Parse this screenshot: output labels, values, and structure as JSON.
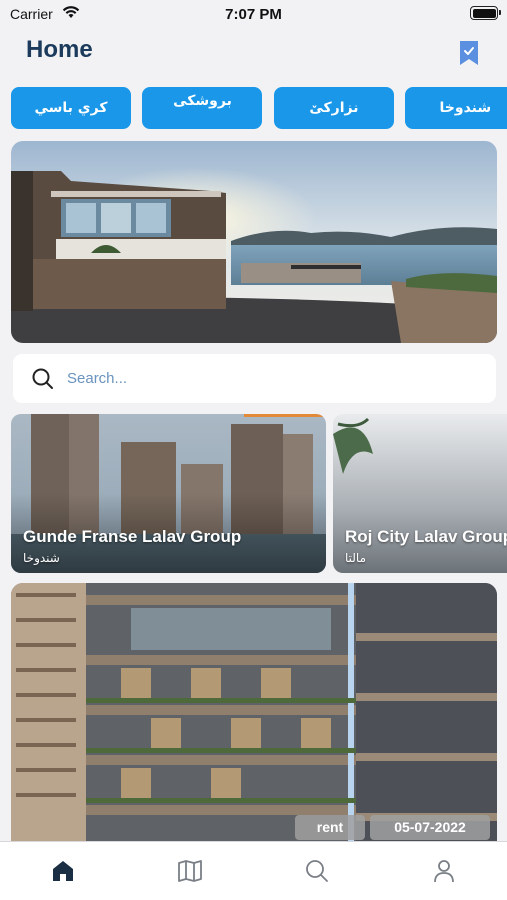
{
  "status_bar": {
    "carrier": "Carrier",
    "time": "7:07 PM"
  },
  "header": {
    "title": "Home",
    "bookmark_icon": "bookmark-check-icon"
  },
  "categories": [
    {
      "label": "كري باسي"
    },
    {
      "label": "بروشكى"
    },
    {
      "label": "نزاركێ"
    },
    {
      "label": "شندوخا"
    }
  ],
  "search": {
    "placeholder": "Search..."
  },
  "featured_cards": [
    {
      "title": "Gunde Franse Lalav Group",
      "subtitle": "شندوخا"
    },
    {
      "title": "Roj City Lalav Group",
      "subtitle": "مالتا"
    }
  ],
  "listing": {
    "type_tag": "rent",
    "date_tag": "05-07-2022"
  },
  "tabbar": {
    "tabs": [
      {
        "icon": "home-icon",
        "active": true
      },
      {
        "icon": "map-icon",
        "active": false
      },
      {
        "icon": "search-icon",
        "active": false
      },
      {
        "icon": "profile-icon",
        "active": false
      }
    ]
  },
  "colors": {
    "accent": "#1a97e8",
    "title": "#1b3a5c",
    "background": "#f2f2f4"
  }
}
